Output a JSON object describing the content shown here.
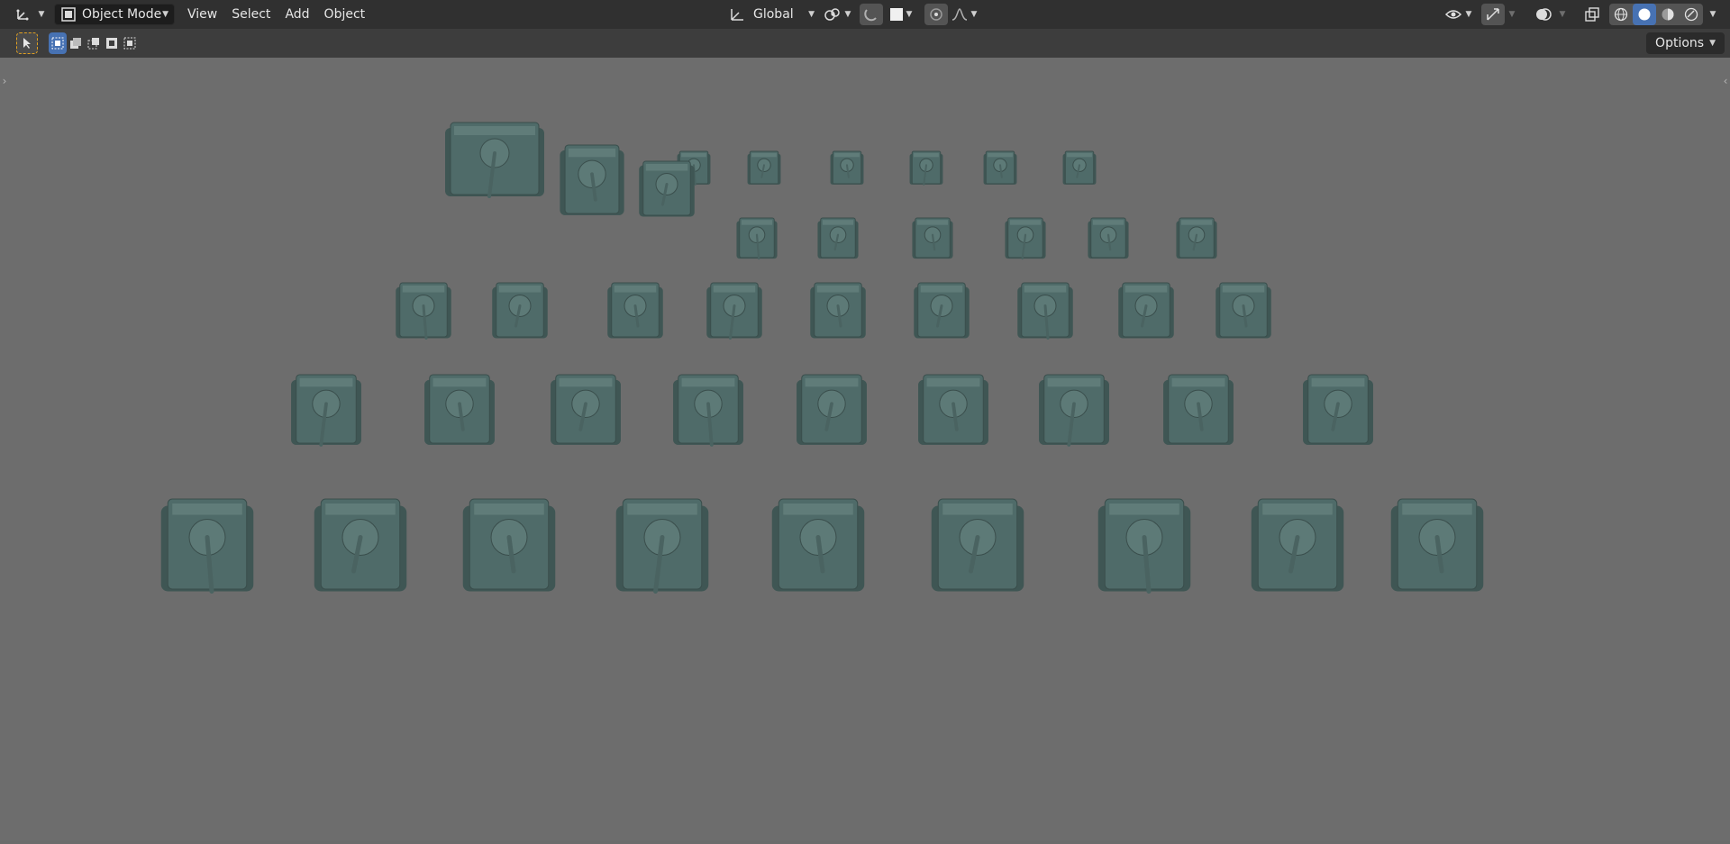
{
  "header": {
    "mode_label": "Object Mode",
    "menu": [
      "View",
      "Select",
      "Add",
      "Object"
    ],
    "orientation_label": "Global"
  },
  "toolbar": {
    "options_label": "Options"
  },
  "viewport": {
    "object_color": "#4f6b69",
    "background": "#6d6d6d"
  }
}
